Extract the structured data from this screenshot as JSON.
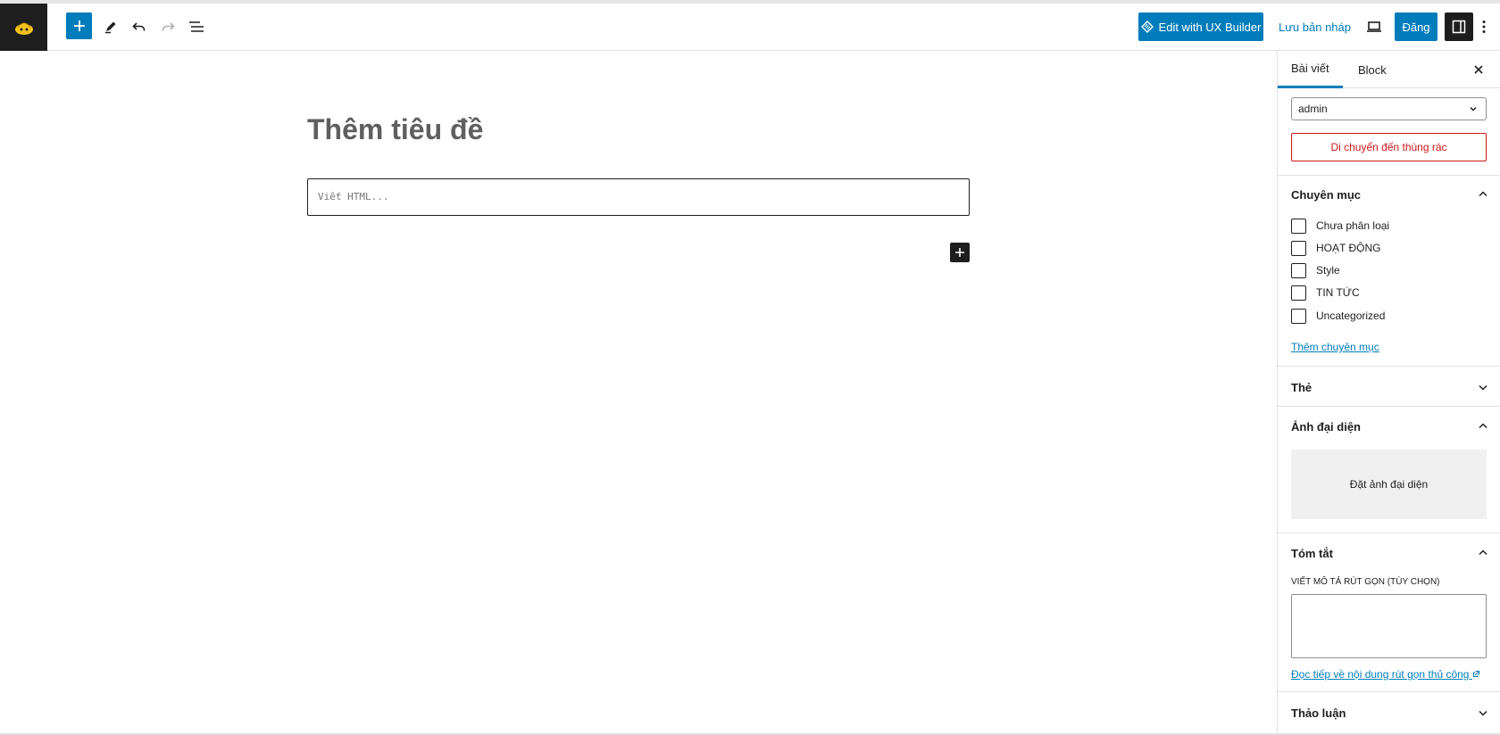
{
  "toolbar": {
    "ux_builder_label": "Edit with UX Builder",
    "save_draft_label": "Lưu bản nháp",
    "publish_label": "Đăng"
  },
  "editor": {
    "title_placeholder": "Thêm tiêu đề",
    "html_placeholder": "Viết HTML..."
  },
  "sidebar": {
    "tabs": [
      {
        "label": "Bài viết",
        "active": true
      },
      {
        "label": "Block",
        "active": false
      }
    ],
    "author_value": "admin",
    "trash_label": "Di chuyển đến thùng rác",
    "categories": {
      "title": "Chuyên mục",
      "items": [
        "Chưa phân loại",
        "HOẠT ĐỘNG",
        "Style",
        "TIN TỨC",
        "Uncategorized"
      ],
      "add_link": "Thêm chuyên mục"
    },
    "tags_title": "Thẻ",
    "featured": {
      "title": "Ảnh đại diện",
      "button": "Đặt ảnh đại diện"
    },
    "excerpt": {
      "title": "Tóm tắt",
      "label": "VIẾT MÔ TẢ RÚT GỌN (TÙY CHỌN)",
      "link": "Đọc tiếp về nội dung rút gọn thủ công"
    },
    "discussion_title": "Thảo luận"
  },
  "colors": {
    "accent": "#007cba",
    "danger": "#cc1818",
    "dark": "#1e1e1e"
  }
}
